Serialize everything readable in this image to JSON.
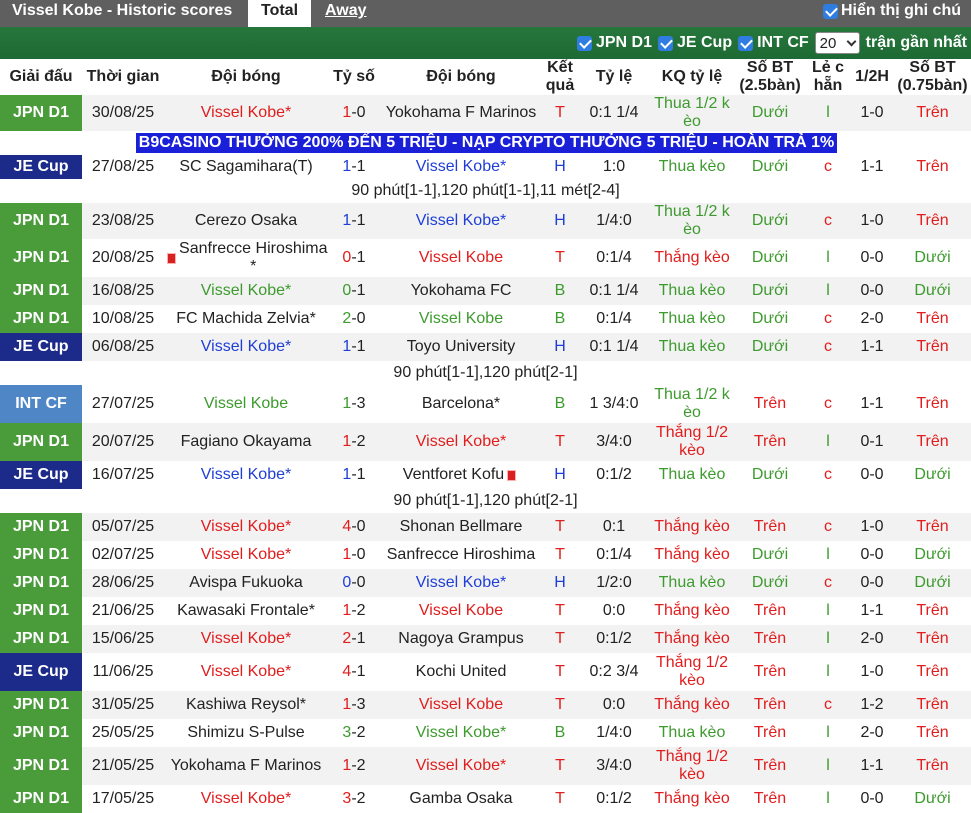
{
  "header": {
    "title": "Vissel Kobe - Historic scores",
    "tab_total": "Total",
    "tab_away": "Away",
    "show_handicap_label": "Hiển thị ghi chú",
    "show_handicap_checked": true
  },
  "filters": {
    "items": [
      {
        "label": "JPN D1",
        "checked": true
      },
      {
        "label": "JE Cup",
        "checked": true
      },
      {
        "label": "INT CF",
        "checked": true
      }
    ],
    "count_value": "20",
    "recent_label": "trận gần nhất"
  },
  "columns": {
    "league": "Giải đấu",
    "date": "Thời gian",
    "home": "Đội bóng",
    "score": "Tỷ số",
    "away": "Đội bóng",
    "result": "Kết quả",
    "odds": "Tỷ lệ",
    "odds_result": "KQ tỷ lệ",
    "ou25": "Số BT (2.5bàn)",
    "oddeven": "Lẻ c hẵn",
    "half": "1/2H",
    "ou075": "Số BT (0.75bàn)"
  },
  "promo": "B9CASINO THƯỞNG 200% ĐẾN 5 TRIỆU - NẠP CRYPTO THƯỞNG 5 TRIỆU - HOÀN TRẢ 1%",
  "matches": [
    {
      "league": "JPN D1",
      "date": "30/08/25",
      "home": "Vissel Kobe*",
      "home_color": "red",
      "score": "1-0",
      "away": "Yokohama F Marinos",
      "away_color": "dark",
      "result": "T",
      "odds": "0:1 1/4",
      "odds_result": "Thua 1/2 k èo",
      "ou25": "Dưới",
      "oe": "l",
      "half": "1-0",
      "ou075": "Trên"
    },
    {
      "league": "JE Cup",
      "date": "27/08/25",
      "home": "SC Sagamihara(T)",
      "home_color": "dark",
      "score": "1-1",
      "away": "Vissel Kobe*",
      "away_color": "blue",
      "result": "H",
      "odds": "1:0",
      "odds_result": "Thua kèo",
      "ou25": "Dưới",
      "oe": "c",
      "half": "1-1",
      "ou075": "Trên",
      "note": "90 phút[1-1],120 phút[1-1],11 mét[2-4]"
    },
    {
      "league": "JPN D1",
      "date": "23/08/25",
      "home": "Cerezo Osaka",
      "home_color": "dark",
      "score": "1-1",
      "away": "Vissel Kobe*",
      "away_color": "blue",
      "result": "H",
      "odds": "1/4:0",
      "odds_result": "Thua 1/2 k èo",
      "ou25": "Dưới",
      "oe": "c",
      "half": "1-0",
      "ou075": "Trên"
    },
    {
      "league": "JPN D1",
      "date": "20/08/25",
      "home": "Sanfrecce Hiroshima *",
      "home_color": "dark",
      "home_flag": true,
      "score": "0-1",
      "away": "Vissel Kobe",
      "away_color": "red",
      "result": "T",
      "odds": "0:1/4",
      "odds_result": "Thắng kèo",
      "ou25": "Dưới",
      "oe": "l",
      "half": "0-0",
      "ou075": "Dưới"
    },
    {
      "league": "JPN D1",
      "date": "16/08/25",
      "home": "Vissel Kobe*",
      "home_color": "green",
      "score": "0-1",
      "away": "Yokohama FC",
      "away_color": "dark",
      "result": "B",
      "odds": "0:1 1/4",
      "odds_result": "Thua kèo",
      "ou25": "Dưới",
      "oe": "l",
      "half": "0-0",
      "ou075": "Dưới"
    },
    {
      "league": "JPN D1",
      "date": "10/08/25",
      "home": "FC Machida Zelvia*",
      "home_color": "dark",
      "score": "2-0",
      "away": "Vissel Kobe",
      "away_color": "green",
      "result": "B",
      "odds": "0:1/4",
      "odds_result": "Thua kèo",
      "ou25": "Dưới",
      "oe": "c",
      "half": "2-0",
      "ou075": "Trên"
    },
    {
      "league": "JE Cup",
      "date": "06/08/25",
      "home": "Vissel Kobe*",
      "home_color": "blue",
      "score": "1-1",
      "away": "Toyo University",
      "away_color": "dark",
      "result": "H",
      "odds": "0:1 1/4",
      "odds_result": "Thua kèo",
      "ou25": "Dưới",
      "oe": "c",
      "half": "1-1",
      "ou075": "Trên",
      "note": "90 phút[1-1],120 phút[2-1]"
    },
    {
      "league": "INT CF",
      "date": "27/07/25",
      "home": "Vissel Kobe",
      "home_color": "green",
      "score": "1-3",
      "away": "Barcelona*",
      "away_color": "dark",
      "result": "B",
      "odds": "1 3/4:0",
      "odds_result": "Thua 1/2 k èo",
      "ou25": "Trên",
      "oe": "c",
      "half": "1-1",
      "ou075": "Trên"
    },
    {
      "league": "JPN D1",
      "date": "20/07/25",
      "home": "Fagiano Okayama",
      "home_color": "dark",
      "score": "1-2",
      "away": "Vissel Kobe*",
      "away_color": "red",
      "result": "T",
      "odds": "3/4:0",
      "odds_result": "Thắng 1/2 kèo",
      "ou25": "Trên",
      "oe": "l",
      "half": "0-1",
      "ou075": "Trên"
    },
    {
      "league": "JE Cup",
      "date": "16/07/25",
      "home": "Vissel Kobe*",
      "home_color": "blue",
      "score": "1-1",
      "away": "Ventforet Kofu",
      "away_color": "dark",
      "away_flag": true,
      "result": "H",
      "odds": "0:1/2",
      "odds_result": "Thua kèo",
      "ou25": "Dưới",
      "oe": "c",
      "half": "0-0",
      "ou075": "Dưới",
      "note": "90 phút[1-1],120 phút[2-1]"
    },
    {
      "league": "JPN D1",
      "date": "05/07/25",
      "home": "Vissel Kobe*",
      "home_color": "red",
      "score": "4-0",
      "away": "Shonan Bellmare",
      "away_color": "dark",
      "result": "T",
      "odds": "0:1",
      "odds_result": "Thắng kèo",
      "ou25": "Trên",
      "oe": "c",
      "half": "1-0",
      "ou075": "Trên"
    },
    {
      "league": "JPN D1",
      "date": "02/07/25",
      "home": "Vissel Kobe*",
      "home_color": "red",
      "score": "1-0",
      "away": "Sanfrecce Hiroshima",
      "away_color": "dark",
      "result": "T",
      "odds": "0:1/4",
      "odds_result": "Thắng kèo",
      "ou25": "Dưới",
      "oe": "l",
      "half": "0-0",
      "ou075": "Dưới"
    },
    {
      "league": "JPN D1",
      "date": "28/06/25",
      "home": "Avispa Fukuoka",
      "home_color": "dark",
      "score": "0-0",
      "away": "Vissel Kobe*",
      "away_color": "blue",
      "result": "H",
      "odds": "1/2:0",
      "odds_result": "Thua kèo",
      "ou25": "Dưới",
      "oe": "c",
      "half": "0-0",
      "ou075": "Dưới"
    },
    {
      "league": "JPN D1",
      "date": "21/06/25",
      "home": "Kawasaki Frontale*",
      "home_color": "dark",
      "score": "1-2",
      "away": "Vissel Kobe",
      "away_color": "red",
      "result": "T",
      "odds": "0:0",
      "odds_result": "Thắng kèo",
      "ou25": "Trên",
      "oe": "l",
      "half": "1-1",
      "ou075": "Trên"
    },
    {
      "league": "JPN D1",
      "date": "15/06/25",
      "home": "Vissel Kobe*",
      "home_color": "red",
      "score": "2-1",
      "away": "Nagoya Grampus",
      "away_color": "dark",
      "result": "T",
      "odds": "0:1/2",
      "odds_result": "Thắng kèo",
      "ou25": "Trên",
      "oe": "l",
      "half": "2-0",
      "ou075": "Trên"
    },
    {
      "league": "JE Cup",
      "date": "11/06/25",
      "home": "Vissel Kobe*",
      "home_color": "red",
      "score": "4-1",
      "away": "Kochi United",
      "away_color": "dark",
      "result": "T",
      "odds": "0:2 3/4",
      "odds_result": "Thắng 1/2 kèo",
      "ou25": "Trên",
      "oe": "l",
      "half": "1-0",
      "ou075": "Trên"
    },
    {
      "league": "JPN D1",
      "date": "31/05/25",
      "home": "Kashiwa Reysol*",
      "home_color": "dark",
      "score": "1-3",
      "away": "Vissel Kobe",
      "away_color": "red",
      "result": "T",
      "odds": "0:0",
      "odds_result": "Thắng kèo",
      "ou25": "Trên",
      "oe": "c",
      "half": "1-2",
      "ou075": "Trên"
    },
    {
      "league": "JPN D1",
      "date": "25/05/25",
      "home": "Shimizu S-Pulse",
      "home_color": "dark",
      "score": "3-2",
      "away": "Vissel Kobe*",
      "away_color": "green",
      "result": "B",
      "odds": "1/4:0",
      "odds_result": "Thua kèo",
      "ou25": "Trên",
      "oe": "l",
      "half": "2-0",
      "ou075": "Trên"
    },
    {
      "league": "JPN D1",
      "date": "21/05/25",
      "home": "Yokohama F Marinos",
      "home_color": "dark",
      "score": "1-2",
      "away": "Vissel Kobe*",
      "away_color": "red",
      "result": "T",
      "odds": "3/4:0",
      "odds_result": "Thắng 1/2 kèo",
      "ou25": "Trên",
      "oe": "l",
      "half": "1-1",
      "ou075": "Trên"
    },
    {
      "league": "JPN D1",
      "date": "17/05/25",
      "home": "Vissel Kobe*",
      "home_color": "red",
      "score": "3-2",
      "away": "Gamba Osaka",
      "away_color": "dark",
      "result": "T",
      "odds": "0:1/2",
      "odds_result": "Thắng kèo",
      "ou25": "Trên",
      "oe": "l",
      "half": "0-0",
      "ou075": "Dưới"
    }
  ],
  "colors": {
    "topbar": "#5f5f5f",
    "filterbar": "#217038",
    "jpn_d1": "#4a9b3a",
    "je_cup": "#1c2a89",
    "int_cf": "#4f86c6",
    "win": "#e11d1d",
    "draw": "#1f3ed6",
    "loss": "#3d9b2e",
    "promo": "#1a1fd8"
  }
}
